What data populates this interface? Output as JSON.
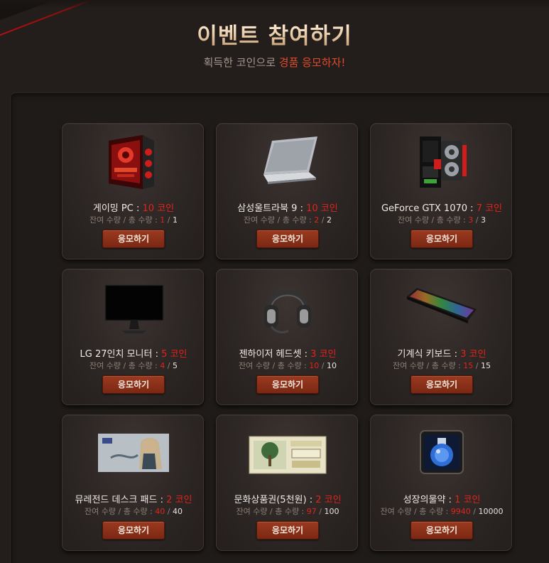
{
  "header": {
    "title": "이벤트 참여하기",
    "subtitle_prefix": "획득한 코인으로 ",
    "subtitle_highlight": "경품 응모하자!"
  },
  "labels": {
    "sep": " : ",
    "remain": "잔여 수량",
    "slash": " / ",
    "total": "총 수량",
    "colon": " : ",
    "qty_slash": " / "
  },
  "colors": {
    "coin": "#e3231b",
    "button": "#8a3119",
    "accent": "#e04b2c"
  },
  "items": [
    {
      "name": "게이밍 PC",
      "coin": "10 코인",
      "remaining": "1",
      "total": "1",
      "button": "응모하기",
      "icon": "gaming-pc-icon"
    },
    {
      "name": "삼성울트라북 9",
      "coin": "10 코인",
      "remaining": "2",
      "total": "2",
      "button": "응모하기",
      "icon": "laptop-icon"
    },
    {
      "name": "GeForce GTX 1070",
      "coin": "7 코인",
      "remaining": "3",
      "total": "3",
      "button": "응모하기",
      "icon": "graphics-card-icon"
    },
    {
      "name": "LG 27인치 모니터",
      "coin": "5 코인",
      "remaining": "4",
      "total": "5",
      "button": "응모하기",
      "icon": "monitor-icon"
    },
    {
      "name": "젠하이저 헤드셋",
      "coin": "3 코인",
      "remaining": "10",
      "total": "10",
      "button": "응모하기",
      "icon": "headset-icon"
    },
    {
      "name": "기계식 키보드",
      "coin": "3 코인",
      "remaining": "15",
      "total": "15",
      "button": "응모하기",
      "icon": "keyboard-icon"
    },
    {
      "name": "뮤레전드 데스크 패드",
      "coin": "2 코인",
      "remaining": "40",
      "total": "40",
      "button": "응모하기",
      "icon": "desk-pad-icon"
    },
    {
      "name": "문화상품권(5천원)",
      "coin": "2 코인",
      "remaining": "97",
      "total": "100",
      "button": "응모하기",
      "icon": "gift-voucher-icon"
    },
    {
      "name": "성장의물약",
      "coin": "1 코인",
      "remaining": "9940",
      "total": "10000",
      "button": "응모하기",
      "icon": "potion-icon"
    }
  ]
}
